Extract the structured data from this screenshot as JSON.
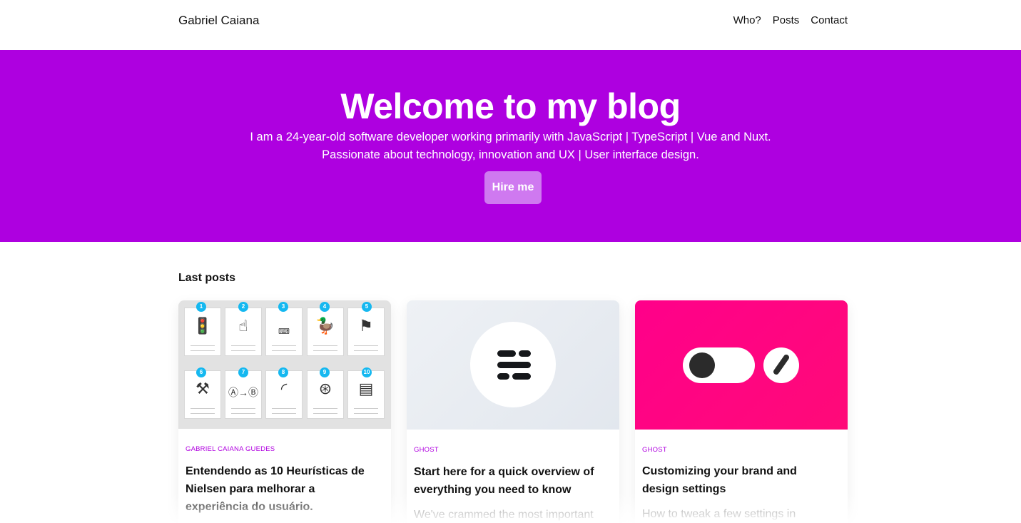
{
  "header": {
    "brand": "Gabriel Caiana",
    "nav": [
      "Who?",
      "Posts",
      "Contact"
    ]
  },
  "hero": {
    "title": "Welcome to my blog",
    "line1": "I am a 24-year-old software developer working primarily with JavaScript | TypeScript | Vue and Nuxt.",
    "line2": "Passionate about technology, innovation and UX | User interface design.",
    "cta": "Hire me",
    "background": "#ae00e0"
  },
  "posts_section": {
    "title": "Last posts",
    "cards": [
      {
        "tag": "GABRIEL CAIANA GUEDES",
        "title": "Entendendo as 10 Heurísticas de Nielsen para melhorar a experiência do usuário.",
        "excerpt": "",
        "thumb": [
          "1",
          "2",
          "3",
          "4",
          "5",
          "6",
          "7",
          "8",
          "9",
          "10"
        ]
      },
      {
        "tag": "GHOST",
        "title": "Start here for a quick overview of everything you need to know",
        "excerpt": "We've crammed the most important"
      },
      {
        "tag": "GHOST",
        "title": "Customizing your brand and design settings",
        "excerpt": "How to tweak a few settings in"
      }
    ]
  },
  "colors": {
    "accent": "#ae00e0",
    "tag": "#b000e0",
    "button": "#cf79f0",
    "ghost_pink": "#ff008a"
  }
}
